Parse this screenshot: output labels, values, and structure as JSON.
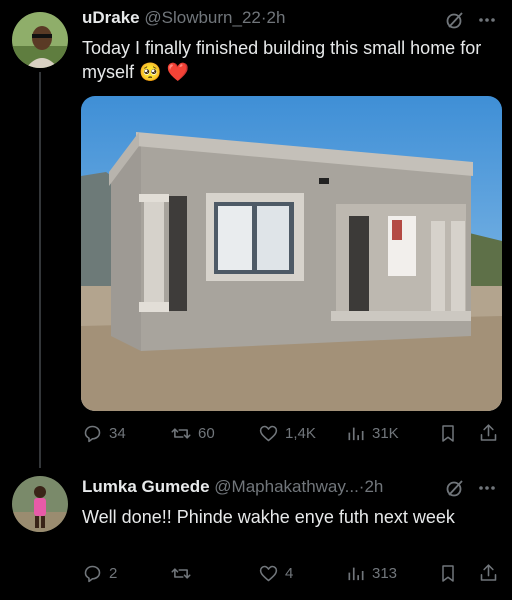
{
  "post": {
    "display_name": "uDrake",
    "handle": "@Slowburn_22",
    "separator": "·",
    "time": "2h",
    "text": "Today I finally finished building this small home for myself",
    "emoji_1": "🥺",
    "emoji_2": "❤️",
    "replies": "34",
    "reposts": "60",
    "likes": "1,4K",
    "views": "31K"
  },
  "reply": {
    "display_name": "Lumka Gumede",
    "handle": "@Maphakathway...",
    "separator": "·",
    "time": "2h",
    "text": "Well done!!  Phinde wakhe enye futh next week",
    "replies": "2",
    "reposts": "",
    "likes": "4",
    "views": "313"
  },
  "colors": {
    "background": "#000000",
    "text": "#e7e9ea",
    "muted": "#71767b",
    "heart": "#f91880"
  },
  "icons": [
    "grok-icon",
    "more-icon",
    "reply-icon",
    "repost-icon",
    "like-icon",
    "views-icon",
    "bookmark-icon",
    "share-icon"
  ]
}
